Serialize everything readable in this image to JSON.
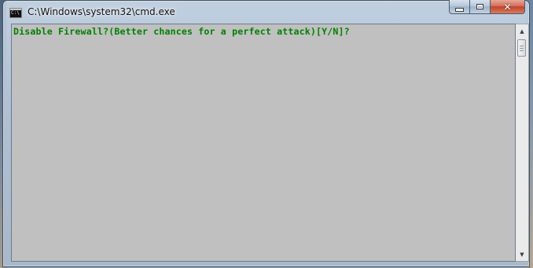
{
  "window": {
    "title": "C:\\Windows\\system32\\cmd.exe",
    "icon": "cmd-app-icon",
    "icon_text": "C:\\",
    "controls": {
      "minimize_icon": "minimize-icon",
      "maximize_icon": "maximize-icon",
      "close_label": "✕"
    }
  },
  "console": {
    "lines": [
      "Disable Firewall?(Better chances for a perfect attack)[Y/N]?"
    ],
    "text_color": "#008000",
    "background_color": "#c0c0c0"
  },
  "scrollbar": {
    "up_arrow": "▲",
    "down_arrow": "▼"
  }
}
